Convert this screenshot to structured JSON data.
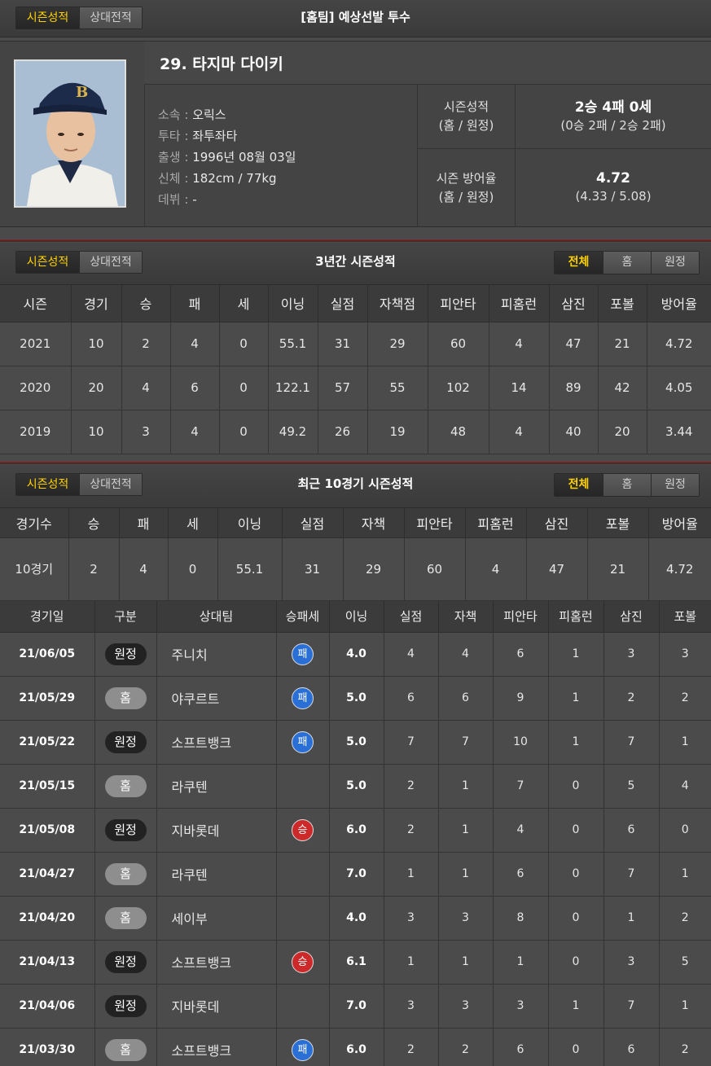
{
  "tabs": [
    "시즌성적",
    "상대전적"
  ],
  "header_title": "[홈팀] 예상선발 투수",
  "player": {
    "name": "29. 타지마 다이키",
    "info": [
      {
        "key": "소속",
        "value": "오릭스"
      },
      {
        "key": "투타",
        "value": "좌투좌타"
      },
      {
        "key": "출생",
        "value": "1996년 08월 03일"
      },
      {
        "key": "신체",
        "value": "182cm / 77kg"
      },
      {
        "key": "데뷔",
        "value": "-"
      }
    ],
    "record_label_1": "시즌성적",
    "record_label_2": "(홈 / 원정)",
    "record_main": "2승 4패 0세",
    "record_sub": "(0승 2패 / 2승 2패)",
    "era_label_1": "시즌 방어율",
    "era_label_2": "(홈 / 원정)",
    "era_main": "4.72",
    "era_sub": "(4.33 / 5.08)"
  },
  "filter": [
    "전체",
    "홈",
    "원정"
  ],
  "season_section": {
    "title": "3년간 시즌성적",
    "columns": [
      "시즌",
      "경기",
      "승",
      "패",
      "세",
      "이닝",
      "실점",
      "자책점",
      "피안타",
      "피홈런",
      "삼진",
      "포볼",
      "방어율"
    ],
    "rows": [
      [
        "2021",
        "10",
        "2",
        "4",
        "0",
        "55.1",
        "31",
        "29",
        "60",
        "4",
        "47",
        "21",
        "4.72"
      ],
      [
        "2020",
        "20",
        "4",
        "6",
        "0",
        "122.1",
        "57",
        "55",
        "102",
        "14",
        "89",
        "42",
        "4.05"
      ],
      [
        "2019",
        "10",
        "3",
        "4",
        "0",
        "49.2",
        "26",
        "19",
        "48",
        "4",
        "40",
        "20",
        "3.44"
      ]
    ]
  },
  "recent_section": {
    "title": "최근 10경기 시즌성적",
    "summary_columns": [
      "경기수",
      "승",
      "패",
      "세",
      "이닝",
      "실점",
      "자책",
      "피안타",
      "피홈런",
      "삼진",
      "포볼",
      "방어율"
    ],
    "summary_row": [
      "10경기",
      "2",
      "4",
      "0",
      "55.1",
      "31",
      "29",
      "60",
      "4",
      "47",
      "21",
      "4.72"
    ],
    "game_columns": [
      "경기일",
      "구분",
      "상대팀",
      "승패세",
      "이닝",
      "실점",
      "자책",
      "피안타",
      "피홈런",
      "삼진",
      "포볼"
    ],
    "games": [
      {
        "date": "21/06/05",
        "type": "원정",
        "opp": "주니치",
        "result": "패",
        "inn": "4.0",
        "r": "4",
        "er": "4",
        "h": "6",
        "hr": "1",
        "so": "3",
        "bb": "3"
      },
      {
        "date": "21/05/29",
        "type": "홈",
        "opp": "야쿠르트",
        "result": "패",
        "inn": "5.0",
        "r": "6",
        "er": "6",
        "h": "9",
        "hr": "1",
        "so": "2",
        "bb": "2"
      },
      {
        "date": "21/05/22",
        "type": "원정",
        "opp": "소프트뱅크",
        "result": "패",
        "inn": "5.0",
        "r": "7",
        "er": "7",
        "h": "10",
        "hr": "1",
        "so": "7",
        "bb": "1"
      },
      {
        "date": "21/05/15",
        "type": "홈",
        "opp": "라쿠텐",
        "result": "",
        "inn": "5.0",
        "r": "2",
        "er": "1",
        "h": "7",
        "hr": "0",
        "so": "5",
        "bb": "4"
      },
      {
        "date": "21/05/08",
        "type": "원정",
        "opp": "지바롯데",
        "result": "승",
        "inn": "6.0",
        "r": "2",
        "er": "1",
        "h": "4",
        "hr": "0",
        "so": "6",
        "bb": "0"
      },
      {
        "date": "21/04/27",
        "type": "홈",
        "opp": "라쿠텐",
        "result": "",
        "inn": "7.0",
        "r": "1",
        "er": "1",
        "h": "6",
        "hr": "0",
        "so": "7",
        "bb": "1"
      },
      {
        "date": "21/04/20",
        "type": "홈",
        "opp": "세이부",
        "result": "",
        "inn": "4.0",
        "r": "3",
        "er": "3",
        "h": "8",
        "hr": "0",
        "so": "1",
        "bb": "2"
      },
      {
        "date": "21/04/13",
        "type": "원정",
        "opp": "소프트뱅크",
        "result": "승",
        "inn": "6.1",
        "r": "1",
        "er": "1",
        "h": "1",
        "hr": "0",
        "so": "3",
        "bb": "5"
      },
      {
        "date": "21/04/06",
        "type": "원정",
        "opp": "지바롯데",
        "result": "",
        "inn": "7.0",
        "r": "3",
        "er": "3",
        "h": "3",
        "hr": "1",
        "so": "7",
        "bb": "1"
      },
      {
        "date": "21/03/30",
        "type": "홈",
        "opp": "소프트뱅크",
        "result": "패",
        "inn": "6.0",
        "r": "2",
        "er": "2",
        "h": "6",
        "hr": "0",
        "so": "6",
        "bb": "2"
      }
    ]
  }
}
